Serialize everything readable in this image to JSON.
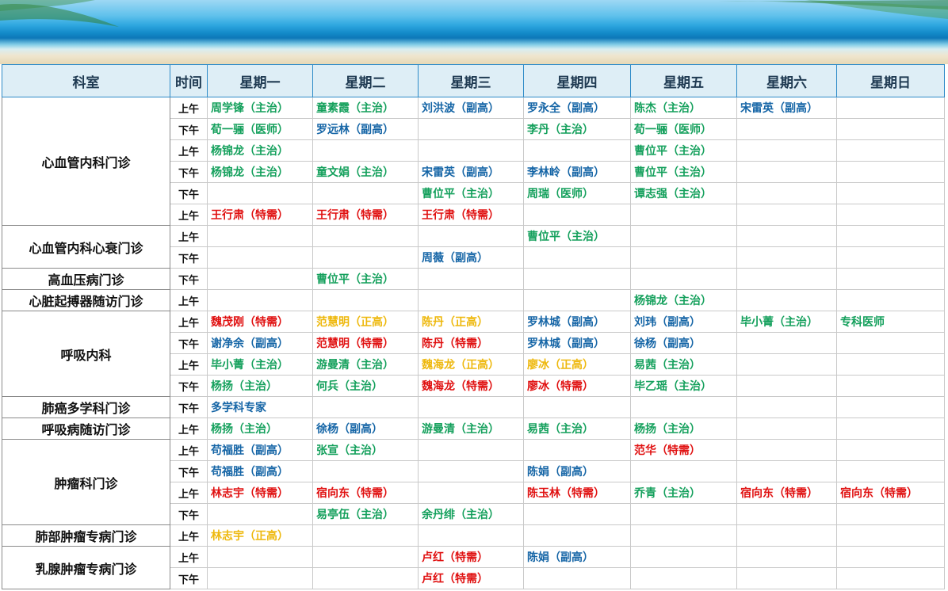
{
  "header": [
    "科室",
    "时间",
    "星期一",
    "星期二",
    "星期三",
    "星期四",
    "星期五",
    "星期六",
    "星期日"
  ],
  "colors": {
    "green": "#14a05c",
    "blue": "#1565a6",
    "red": "#e01010",
    "gold": "#eeb80c"
  },
  "icons": {
    "banner": "beach-sea-banner"
  },
  "departments": [
    {
      "name": "心血管内科门诊",
      "rows": [
        {
          "time": "上午",
          "cells": [
            [
              "周学锋（主治）",
              "green"
            ],
            [
              "童素霞（主治）",
              "green"
            ],
            [
              "刘洪波（副高）",
              "blue"
            ],
            [
              "罗永全（副高）",
              "blue"
            ],
            [
              "陈杰（主治）",
              "green"
            ],
            [
              "宋雷英（副高）",
              "blue"
            ],
            [
              "",
              ""
            ]
          ]
        },
        {
          "time": "下午",
          "cells": [
            [
              "荀一骊（医师）",
              "green"
            ],
            [
              "罗远林（副高）",
              "blue"
            ],
            [
              "",
              ""
            ],
            [
              "李丹（主治）",
              "green"
            ],
            [
              "荀一骊（医师）",
              "green"
            ],
            [
              "",
              ""
            ],
            [
              "",
              ""
            ]
          ]
        },
        {
          "time": "上午",
          "cells": [
            [
              "杨锦龙（主治）",
              "green"
            ],
            [
              "",
              ""
            ],
            [
              "",
              ""
            ],
            [
              "",
              ""
            ],
            [
              "曹位平（主治）",
              "green"
            ],
            [
              "",
              ""
            ],
            [
              "",
              ""
            ]
          ]
        },
        {
          "time": "下午",
          "cells": [
            [
              "杨锦龙（主治）",
              "green"
            ],
            [
              "童文娟（主治）",
              "green"
            ],
            [
              "宋雷英（副高）",
              "blue"
            ],
            [
              "李林岭（副高）",
              "blue"
            ],
            [
              "曹位平（主治）",
              "green"
            ],
            [
              "",
              ""
            ],
            [
              "",
              ""
            ]
          ]
        },
        {
          "time": "下午",
          "cells": [
            [
              "",
              ""
            ],
            [
              "",
              ""
            ],
            [
              "曹位平（主治）",
              "green"
            ],
            [
              "周瑞（医师）",
              "green"
            ],
            [
              "谭志强（主治）",
              "green"
            ],
            [
              "",
              ""
            ],
            [
              "",
              ""
            ]
          ]
        },
        {
          "time": "上午",
          "cells": [
            [
              "王行肃（特需）",
              "red"
            ],
            [
              "王行肃（特需）",
              "red"
            ],
            [
              "王行肃（特需）",
              "red"
            ],
            [
              "",
              ""
            ],
            [
              "",
              ""
            ],
            [
              "",
              ""
            ],
            [
              "",
              ""
            ]
          ]
        }
      ]
    },
    {
      "name": "心血管内科心衰门诊",
      "rows": [
        {
          "time": "上午",
          "cells": [
            [
              "",
              ""
            ],
            [
              "",
              ""
            ],
            [
              "",
              ""
            ],
            [
              "曹位平（主治）",
              "green"
            ],
            [
              "",
              ""
            ],
            [
              "",
              ""
            ],
            [
              "",
              ""
            ]
          ]
        },
        {
          "time": "下午",
          "cells": [
            [
              "",
              ""
            ],
            [
              "",
              ""
            ],
            [
              "周薇（副高）",
              "blue"
            ],
            [
              "",
              ""
            ],
            [
              "",
              ""
            ],
            [
              "",
              ""
            ],
            [
              "",
              ""
            ]
          ]
        }
      ]
    },
    {
      "name": "高血压病门诊",
      "rows": [
        {
          "time": "下午",
          "cells": [
            [
              "",
              ""
            ],
            [
              "曹位平（主治）",
              "green"
            ],
            [
              "",
              ""
            ],
            [
              "",
              ""
            ],
            [
              "",
              ""
            ],
            [
              "",
              ""
            ],
            [
              "",
              ""
            ]
          ]
        }
      ]
    },
    {
      "name": "心脏起搏器随访门诊",
      "rows": [
        {
          "time": "上午",
          "cells": [
            [
              "",
              ""
            ],
            [
              "",
              ""
            ],
            [
              "",
              ""
            ],
            [
              "",
              ""
            ],
            [
              "杨锦龙（主治）",
              "green"
            ],
            [
              "",
              ""
            ],
            [
              "",
              ""
            ]
          ]
        }
      ]
    },
    {
      "name": "呼吸内科",
      "rows": [
        {
          "time": "上午",
          "cells": [
            [
              "魏茂刚（特需）",
              "red"
            ],
            [
              "范慧明（正高）",
              "gold"
            ],
            [
              "陈丹（正高）",
              "gold"
            ],
            [
              "罗林城（副高）",
              "blue"
            ],
            [
              "刘玮（副高）",
              "blue"
            ],
            [
              "毕小菁（主治）",
              "green"
            ],
            [
              "专科医师",
              "green"
            ]
          ]
        },
        {
          "time": "下午",
          "cells": [
            [
              "谢净余（副高）",
              "blue"
            ],
            [
              "范慧明（特需）",
              "red"
            ],
            [
              "陈丹（特需）",
              "red"
            ],
            [
              "罗林城（副高）",
              "blue"
            ],
            [
              "徐杨（副高）",
              "blue"
            ],
            [
              "",
              ""
            ],
            [
              "",
              ""
            ]
          ]
        },
        {
          "time": "上午",
          "cells": [
            [
              "毕小菁（主治）",
              "green"
            ],
            [
              "游曼清（主治）",
              "green"
            ],
            [
              "魏海龙（正高）",
              "gold"
            ],
            [
              "廖冰（正高）",
              "gold"
            ],
            [
              "易茜（主治）",
              "green"
            ],
            [
              "",
              ""
            ],
            [
              "",
              ""
            ]
          ]
        },
        {
          "time": "下午",
          "cells": [
            [
              "杨扬（主治）",
              "green"
            ],
            [
              "何兵（主治）",
              "green"
            ],
            [
              "魏海龙（特需）",
              "red"
            ],
            [
              "廖冰（特需）",
              "red"
            ],
            [
              "毕乙瑶（主治）",
              "green"
            ],
            [
              "",
              ""
            ],
            [
              "",
              ""
            ]
          ]
        }
      ]
    },
    {
      "name": "肺癌多学科门诊",
      "rows": [
        {
          "time": "下午",
          "cells": [
            [
              "多学科专家",
              "blue"
            ],
            [
              "",
              ""
            ],
            [
              "",
              ""
            ],
            [
              "",
              ""
            ],
            [
              "",
              ""
            ],
            [
              "",
              ""
            ],
            [
              "",
              ""
            ]
          ]
        }
      ]
    },
    {
      "name": "呼吸病随访门诊",
      "rows": [
        {
          "time": "上午",
          "cells": [
            [
              "杨扬（主治）",
              "green"
            ],
            [
              "徐杨（副高）",
              "blue"
            ],
            [
              "游曼清（主治）",
              "green"
            ],
            [
              "易茜（主治）",
              "green"
            ],
            [
              "杨扬（主治）",
              "green"
            ],
            [
              "",
              ""
            ],
            [
              "",
              ""
            ]
          ]
        }
      ]
    },
    {
      "name": "肿瘤科门诊",
      "rows": [
        {
          "time": "上午",
          "cells": [
            [
              "苟福胜（副高）",
              "blue"
            ],
            [
              "张宣（主治）",
              "green"
            ],
            [
              "",
              ""
            ],
            [
              "",
              ""
            ],
            [
              "范华（特需）",
              "red"
            ],
            [
              "",
              ""
            ],
            [
              "",
              ""
            ]
          ]
        },
        {
          "time": "下午",
          "cells": [
            [
              "苟福胜（副高）",
              "blue"
            ],
            [
              "",
              ""
            ],
            [
              "",
              ""
            ],
            [
              "陈娟（副高）",
              "blue"
            ],
            [
              "",
              ""
            ],
            [
              "",
              ""
            ],
            [
              "",
              ""
            ]
          ]
        },
        {
          "time": "上午",
          "cells": [
            [
              "林志宇（特需）",
              "red"
            ],
            [
              "宿向东（特需）",
              "red"
            ],
            [
              "",
              ""
            ],
            [
              "陈玉林（特需）",
              "red"
            ],
            [
              "乔青（主治）",
              "green"
            ],
            [
              "宿向东（特需）",
              "red"
            ],
            [
              "宿向东（特需）",
              "red"
            ]
          ]
        },
        {
          "time": "下午",
          "cells": [
            [
              "",
              ""
            ],
            [
              "易亭伍（主治）",
              "green"
            ],
            [
              "余丹绯（主治）",
              "green"
            ],
            [
              "",
              ""
            ],
            [
              "",
              ""
            ],
            [
              "",
              ""
            ],
            [
              "",
              ""
            ]
          ]
        }
      ]
    },
    {
      "name": "肺部肿瘤专病门诊",
      "rows": [
        {
          "time": "上午",
          "cells": [
            [
              "林志宇（正高）",
              "gold"
            ],
            [
              "",
              ""
            ],
            [
              "",
              ""
            ],
            [
              "",
              ""
            ],
            [
              "",
              ""
            ],
            [
              "",
              ""
            ],
            [
              "",
              ""
            ]
          ]
        }
      ]
    },
    {
      "name": "乳腺肿瘤专病门诊",
      "rows": [
        {
          "time": "上午",
          "cells": [
            [
              "",
              ""
            ],
            [
              "",
              ""
            ],
            [
              "卢红（特需）",
              "red"
            ],
            [
              "陈娟（副高）",
              "blue"
            ],
            [
              "",
              ""
            ],
            [
              "",
              ""
            ],
            [
              "",
              ""
            ]
          ]
        },
        {
          "time": "下午",
          "cells": [
            [
              "",
              ""
            ],
            [
              "",
              ""
            ],
            [
              "卢红（特需）",
              "red"
            ],
            [
              "",
              ""
            ],
            [
              "",
              ""
            ],
            [
              "",
              ""
            ],
            [
              "",
              ""
            ]
          ]
        }
      ]
    }
  ]
}
